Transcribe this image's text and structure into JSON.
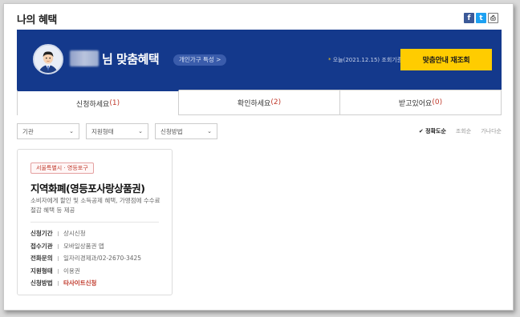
{
  "page": {
    "title": "나의 혜택"
  },
  "share": {
    "facebook": "f",
    "twitter": "t",
    "print": "⎙"
  },
  "banner": {
    "greeting": "님 맞춤혜택",
    "pill_label": "개인가구 특성 >",
    "today_text": "오늘(2021.12.15) 조회기준",
    "reset_button": "맞춤안내 재조회"
  },
  "tabs": [
    {
      "label": "신청하세요",
      "count": "(1)"
    },
    {
      "label": "확인하세요",
      "count": "(2)"
    },
    {
      "label": "받고있어요",
      "count": "(0)"
    }
  ],
  "filters": [
    {
      "label": "기관"
    },
    {
      "label": "지원형태"
    },
    {
      "label": "신청방법"
    }
  ],
  "sort": {
    "options": [
      "정확도순",
      "조회순",
      "가나다순"
    ],
    "selected": "정확도순"
  },
  "card": {
    "region": "서울특별시 · 영등포구",
    "title": "지역화폐(영등포사랑상품권)",
    "description": "소비자에게 할인 및 소득공제 혜택, 가맹점에 수수료 절감 혜택 등 제공",
    "rows": [
      {
        "key": "신청기간",
        "value": "상시신청"
      },
      {
        "key": "접수기관",
        "value": "모바일상품권 앱"
      },
      {
        "key": "전화문의",
        "value": "일자리경제과/02-2670-3425"
      },
      {
        "key": "지원형태",
        "value": "이용권"
      },
      {
        "key": "신청방법",
        "value": "타사이트신청"
      }
    ]
  },
  "colors": {
    "banner": "#14398c",
    "accent_button": "#ffcc00",
    "highlight_red": "#c0392b"
  }
}
